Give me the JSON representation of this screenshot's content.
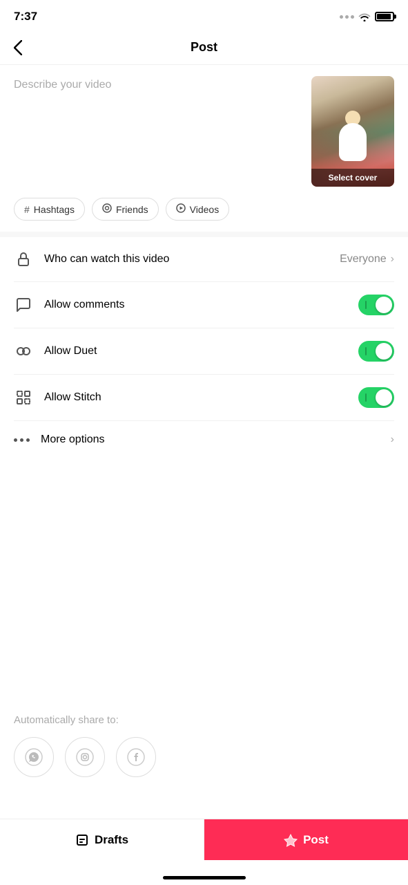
{
  "statusBar": {
    "time": "7:37"
  },
  "header": {
    "back_label": "‹",
    "title": "Post"
  },
  "description": {
    "placeholder": "Describe your video"
  },
  "thumbnail": {
    "select_cover_label": "Select cover"
  },
  "tags": [
    {
      "id": "hashtags",
      "icon": "#",
      "label": "Hashtags"
    },
    {
      "id": "friends",
      "icon": "@",
      "label": "Friends"
    },
    {
      "id": "videos",
      "icon": "▷",
      "label": "Videos"
    }
  ],
  "settings": [
    {
      "id": "who-can-watch",
      "label": "Who can watch this video",
      "value": "Everyone",
      "has_chevron": true,
      "has_toggle": false
    },
    {
      "id": "allow-comments",
      "label": "Allow comments",
      "has_toggle": true,
      "toggle_on": true
    },
    {
      "id": "allow-duet",
      "label": "Allow Duet",
      "has_toggle": true,
      "toggle_on": true
    },
    {
      "id": "allow-stitch",
      "label": "Allow Stitch",
      "has_toggle": true,
      "toggle_on": true
    }
  ],
  "moreOptions": {
    "label": "More options"
  },
  "share": {
    "label": "Automatically share to:"
  },
  "bottomBar": {
    "drafts_label": "Drafts",
    "post_label": "Post"
  }
}
